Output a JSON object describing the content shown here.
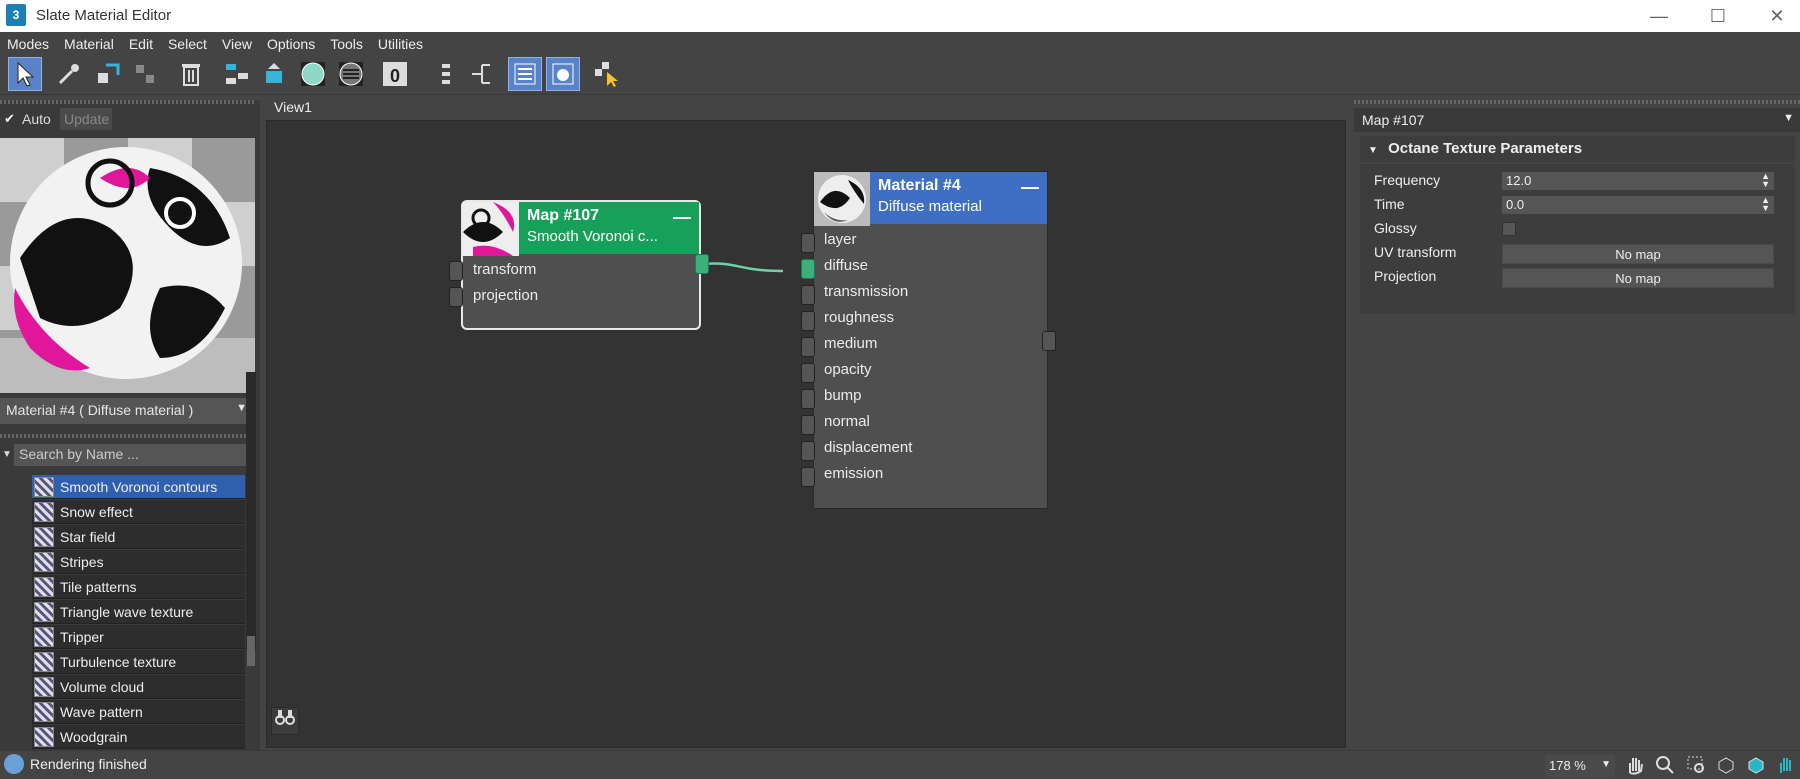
{
  "window": {
    "title": "Slate Material Editor",
    "app_icon_label": "3"
  },
  "menu": [
    "Modes",
    "Material",
    "Edit",
    "Select",
    "View",
    "Options",
    "Tools",
    "Utilities"
  ],
  "left": {
    "auto_label": "Auto",
    "update_label": "Update",
    "material_selector": "Material #4  ( Diffuse material )",
    "search_placeholder": "Search by Name ...",
    "maps": [
      "Smooth Voronoi contours",
      "Snow effect",
      "Star field",
      "Stripes",
      "Tile patterns",
      "Triangle wave texture",
      "Tripper",
      "Turbulence texture",
      "Volume cloud",
      "Wave pattern",
      "Woodgrain"
    ],
    "selected_map": "Smooth Voronoi contours"
  },
  "view": {
    "tab": "View1"
  },
  "nodes": {
    "map": {
      "title": "Map #107",
      "subtitle": "Smooth Voronoi c...",
      "slots": [
        "transform",
        "projection"
      ],
      "color": "#17a05a"
    },
    "material": {
      "title": "Material #4",
      "subtitle": "Diffuse material",
      "slots": [
        "layer",
        "diffuse",
        "transmission",
        "roughness",
        "medium",
        "opacity",
        "bump",
        "normal",
        "displacement",
        "emission"
      ],
      "color": "#3f6fc2"
    }
  },
  "right": {
    "title": "Map #107",
    "section": "Octane Texture Parameters",
    "params": {
      "frequency_label": "Frequency",
      "frequency_value": "12.0",
      "time_label": "Time",
      "time_value": "0.0",
      "glossy_label": "Glossy",
      "uv_label": "UV transform",
      "uv_value": "No map",
      "projection_label": "Projection",
      "projection_value": "No map"
    }
  },
  "status": {
    "text": "Rendering finished",
    "zoom": "178 %"
  }
}
